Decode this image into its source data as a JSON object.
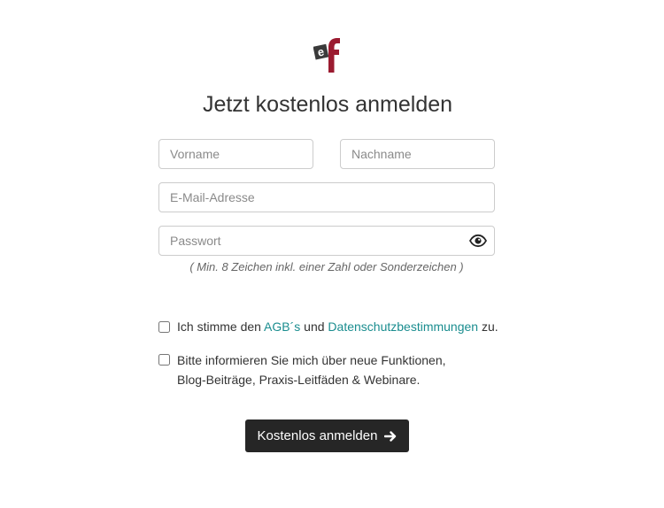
{
  "logo": {
    "letters": "ef",
    "accent_color": "#9b1b30",
    "secondary_color": "#3a3a3a"
  },
  "form": {
    "title": "Jetzt kostenlos anmelden",
    "firstname_placeholder": "Vorname",
    "lastname_placeholder": "Nachname",
    "email_placeholder": "E-Mail-Adresse",
    "password_placeholder": "Passwort",
    "password_toggle_icon": "eye-icon",
    "password_hint": "( Min. 8 Zeichen inkl. einer Zahl oder Sonderzeichen )",
    "terms": {
      "checked": false,
      "prefix": "Ich stimme den ",
      "agb_link": "AGB´s",
      "middle": " und ",
      "privacy_link": "Datenschutzbestimmungen",
      "suffix": " zu."
    },
    "newsletter": {
      "checked": false,
      "label": "Bitte informieren Sie mich über neue Funktionen, Blog-Beiträge, Praxis-Leitfäden & Webinare."
    },
    "submit_label": "Kostenlos anmelden",
    "submit_icon": "arrow-right-icon"
  },
  "colors": {
    "link": "#1a8d8f",
    "button_bg": "#262626",
    "button_text": "#ffffff",
    "border": "#cccccc"
  }
}
